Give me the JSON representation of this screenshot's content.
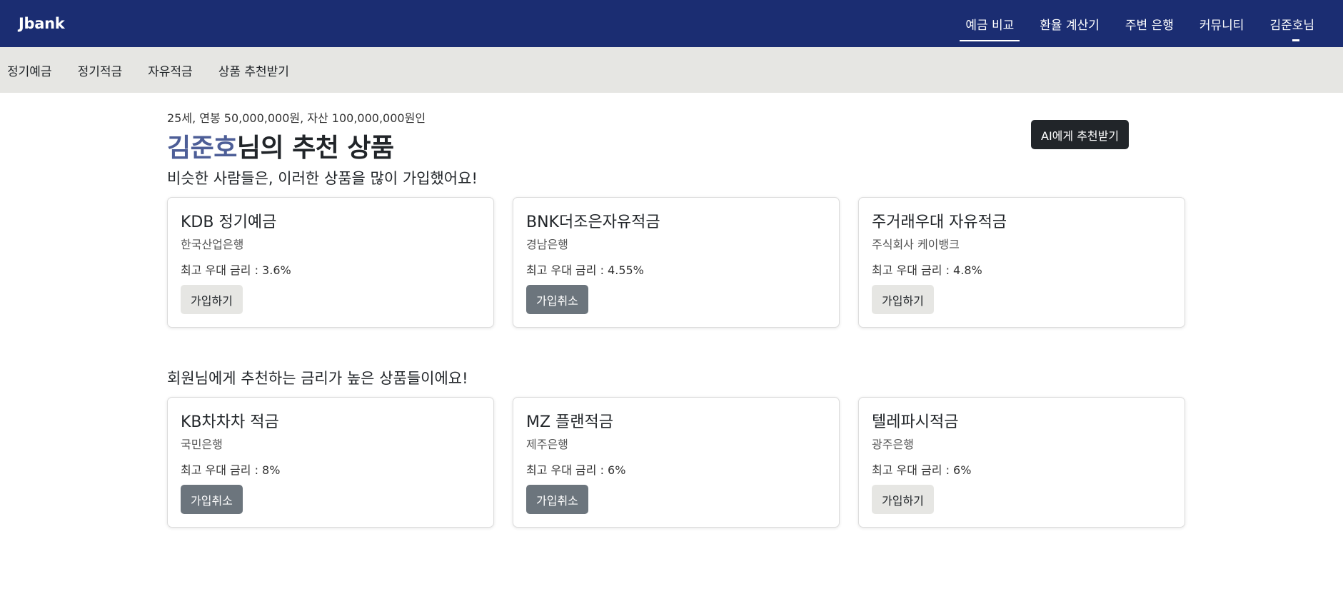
{
  "app": {
    "brand": "Jbank"
  },
  "nav": {
    "items": [
      {
        "label": "예금 비교",
        "active": true
      },
      {
        "label": "환율 계산기",
        "active": false
      },
      {
        "label": "주변 은행",
        "active": false
      },
      {
        "label": "커뮤니티",
        "active": false
      },
      {
        "label": "김준호님",
        "active": false
      }
    ]
  },
  "subnav": {
    "items": [
      "정기예금",
      "정기적금",
      "자유적금",
      "상품 추천받기"
    ]
  },
  "profile": {
    "summary": "25세, 연봉 50,000,000원, 자산 100,000,000원인",
    "name": "김준호",
    "title_suffix": "님의 추천 상품"
  },
  "ai_button": {
    "label": "AI에게 추천받기"
  },
  "sections": [
    {
      "heading": "비슷한 사람들은, 이러한 상품을 많이 가입했어요!",
      "cards": [
        {
          "title": "KDB 정기예금",
          "bank": "한국산업은행",
          "rate": "최고 우대 금리 : 3.6%",
          "button": "가입하기",
          "joined": false
        },
        {
          "title": "BNK더조은자유적금",
          "bank": "경남은행",
          "rate": "최고 우대 금리 : 4.55%",
          "button": "가입취소",
          "joined": true
        },
        {
          "title": "주거래우대 자유적금",
          "bank": "주식회사 케이뱅크",
          "rate": "최고 우대 금리 : 4.8%",
          "button": "가입하기",
          "joined": false
        }
      ]
    },
    {
      "heading": "회원님에게 추천하는 금리가 높은 상품들이에요!",
      "cards": [
        {
          "title": "KB차차차 적금",
          "bank": "국민은행",
          "rate": "최고 우대 금리 : 8%",
          "button": "가입취소",
          "joined": true
        },
        {
          "title": "MZ 플랜적금",
          "bank": "제주은행",
          "rate": "최고 우대 금리 : 6%",
          "button": "가입취소",
          "joined": true
        },
        {
          "title": "텔레파시적금",
          "bank": "광주은행",
          "rate": "최고 우대 금리 : 6%",
          "button": "가입하기",
          "joined": false
        }
      ]
    }
  ],
  "colors": {
    "navbar": "#1b2d72",
    "subnav": "#e6e6e3",
    "name_accent": "#4d5e97",
    "cancel_button": "#6c757d",
    "join_button": "#e6e6e3",
    "ai_button": "#212529"
  }
}
